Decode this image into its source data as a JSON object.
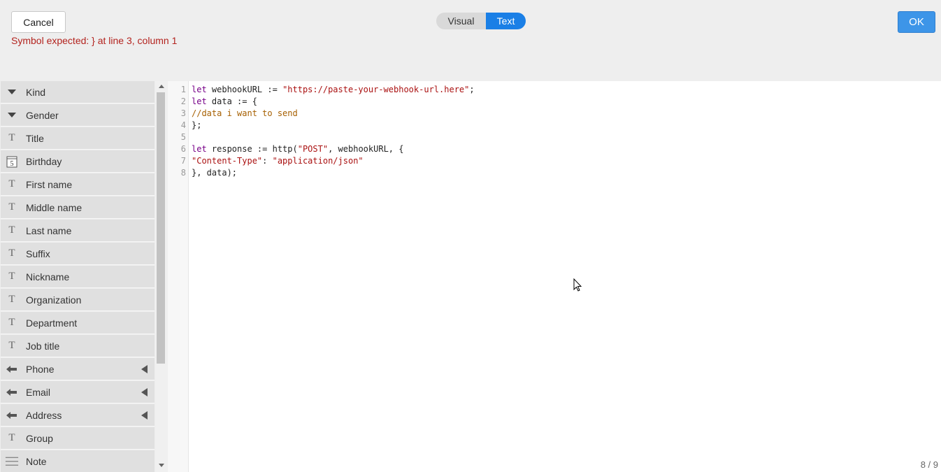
{
  "header": {
    "cancel_label": "Cancel",
    "ok_label": "OK",
    "error_message": "Symbol expected: } at line 3, column 1",
    "toggle": {
      "visual_label": "Visual",
      "text_label": "Text",
      "active": "Text"
    }
  },
  "sidebar": {
    "fields": [
      {
        "label": "Kind",
        "icon": "dropdown-icon"
      },
      {
        "label": "Gender",
        "icon": "dropdown-icon"
      },
      {
        "label": "Title",
        "icon": "text-icon"
      },
      {
        "label": "Birthday",
        "icon": "calendar-icon",
        "icon_text": "5"
      },
      {
        "label": "First name",
        "icon": "text-icon"
      },
      {
        "label": "Middle name",
        "icon": "text-icon"
      },
      {
        "label": "Last name",
        "icon": "text-icon"
      },
      {
        "label": "Suffix",
        "icon": "text-icon"
      },
      {
        "label": "Nickname",
        "icon": "text-icon"
      },
      {
        "label": "Organization",
        "icon": "text-icon"
      },
      {
        "label": "Department",
        "icon": "text-icon"
      },
      {
        "label": "Job title",
        "icon": "text-icon"
      },
      {
        "label": "Phone",
        "icon": "list-icon",
        "expandable": true
      },
      {
        "label": "Email",
        "icon": "list-icon",
        "expandable": true
      },
      {
        "label": "Address",
        "icon": "list-icon",
        "expandable": true
      },
      {
        "label": "Group",
        "icon": "text-icon"
      },
      {
        "label": "Note",
        "icon": "paragraph-icon"
      }
    ],
    "text_glyph": "T"
  },
  "editor": {
    "line_numbers": [
      "1",
      "2",
      "3",
      "4",
      "5",
      "6",
      "7",
      "8"
    ],
    "lines": [
      [
        {
          "t": "let",
          "c": "kw"
        },
        {
          "t": " webhookURL := ",
          "c": ""
        },
        {
          "t": "\"https://paste-your-webhook-url.here\"",
          "c": "str"
        },
        {
          "t": ";",
          "c": ""
        }
      ],
      [
        {
          "t": "let",
          "c": "kw"
        },
        {
          "t": " data := {",
          "c": ""
        }
      ],
      [
        {
          "t": "//data i want to send",
          "c": "cm"
        }
      ],
      [
        {
          "t": "};",
          "c": ""
        }
      ],
      [],
      [
        {
          "t": "let",
          "c": "kw"
        },
        {
          "t": " response := http(",
          "c": ""
        },
        {
          "t": "\"POST\"",
          "c": "str"
        },
        {
          "t": ", webhookURL, {",
          "c": ""
        }
      ],
      [
        {
          "t": "\"Content-Type\"",
          "c": "str"
        },
        {
          "t": ": ",
          "c": ""
        },
        {
          "t": "\"application/json\"",
          "c": "str"
        }
      ],
      [
        {
          "t": "}, data);",
          "c": ""
        }
      ]
    ],
    "status": "8 / 9"
  },
  "colors": {
    "accent": "#1a7fe6",
    "error": "#b3231e",
    "keyword": "#770088",
    "string": "#aa1111",
    "comment": "#a65f00"
  }
}
